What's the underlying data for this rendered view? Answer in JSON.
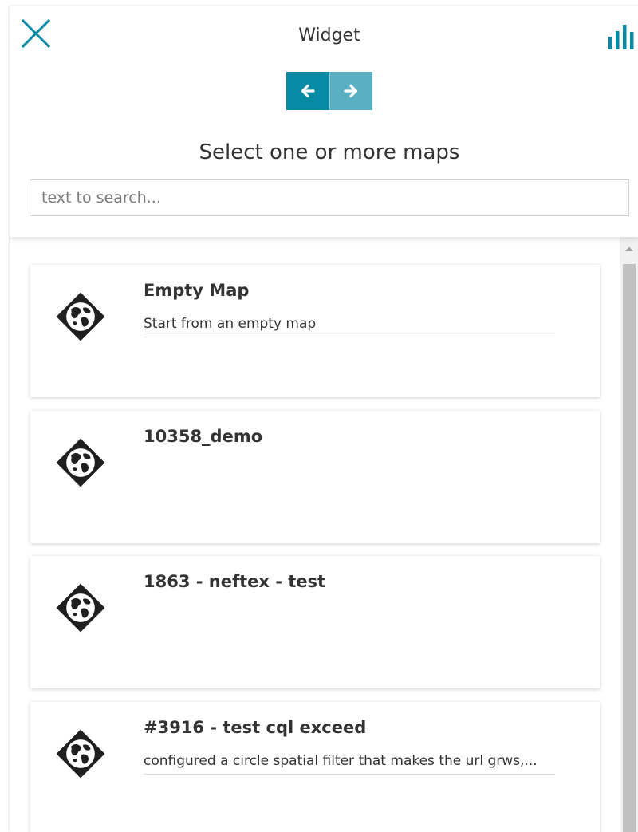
{
  "header": {
    "title": "Widget",
    "close_icon": "close-icon",
    "chart_icon": "bar-chart-icon",
    "accent_color": "#078aa3"
  },
  "nav": {
    "prev_icon": "arrow-left-icon",
    "next_icon": "arrow-right-icon"
  },
  "select_label": "Select one or more maps",
  "search": {
    "placeholder": "text to search...",
    "value": ""
  },
  "maps": [
    {
      "title": "Empty Map",
      "description": "Start from an empty map",
      "icon": "globe-icon"
    },
    {
      "title": "10358_demo",
      "description": "",
      "icon": "globe-icon"
    },
    {
      "title": "1863 - neftex - test",
      "description": "",
      "icon": "globe-icon"
    },
    {
      "title": "#3916 - test cql exceed",
      "description": "configured a circle spatial filter that makes the url grws,...",
      "icon": "globe-icon"
    }
  ]
}
